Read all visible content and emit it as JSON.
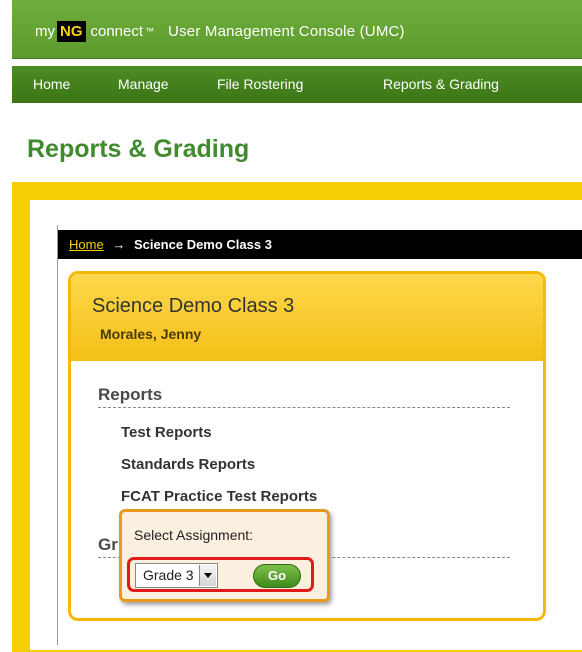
{
  "header": {
    "brand_my": "my",
    "brand_ng": "NG",
    "brand_connect": "connect",
    "brand_tm": "™",
    "app_title": "User Management Console (UMC)"
  },
  "nav": {
    "items": [
      {
        "label": "Home"
      },
      {
        "label": "Manage"
      },
      {
        "label": "File Rostering"
      },
      {
        "label": "Reports & Grading"
      }
    ]
  },
  "page": {
    "title": "Reports & Grading"
  },
  "breadcrumb": {
    "home": "Home",
    "arrow": "→",
    "current": "Science Demo Class 3"
  },
  "card": {
    "title": "Science Demo Class 3",
    "teacher": "Morales, Jenny",
    "reports_heading": "Reports",
    "report_links": [
      {
        "label": "Test Reports"
      },
      {
        "label": "Standards Reports"
      },
      {
        "label": "FCAT Practice Test Reports"
      }
    ],
    "grading_heading": "Gr"
  },
  "popup": {
    "label": "Select Assignment:",
    "selected": "Grade 3",
    "go_label": "Go"
  },
  "colors": {
    "brand_green": "#5c9b2c",
    "nav_green": "#3c7516",
    "title_green": "#3f8b2e",
    "frame_yellow": "#f5cf05",
    "card_border": "#f5b90a",
    "popup_border": "#e99a1c",
    "highlight_red": "#e01a1a"
  }
}
